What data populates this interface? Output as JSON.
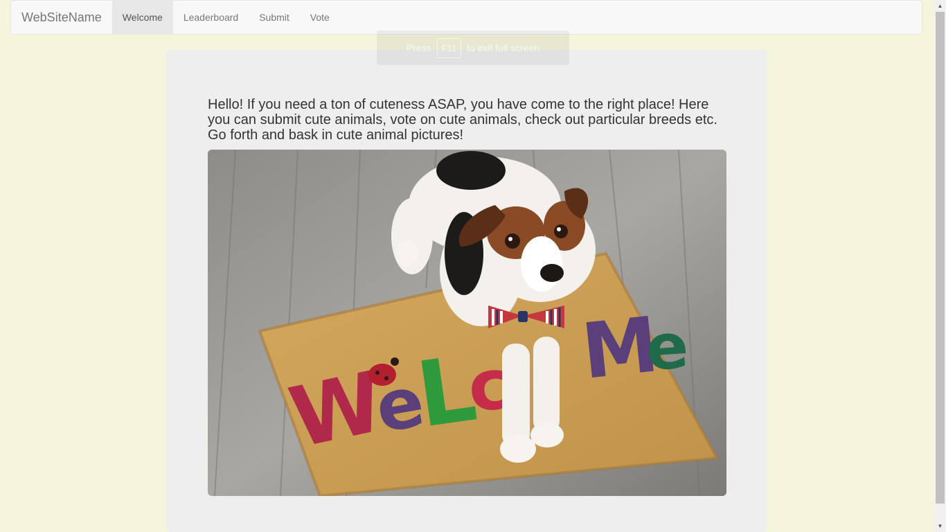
{
  "navbar": {
    "brand": "WebSiteName",
    "items": [
      {
        "label": "Welcome",
        "active": true
      },
      {
        "label": "Leaderboard",
        "active": false
      },
      {
        "label": "Submit",
        "active": false
      },
      {
        "label": "Vote",
        "active": false
      }
    ]
  },
  "fullscreen_toast": {
    "press": "Press",
    "key": "F11",
    "suffix": "to exit full screen"
  },
  "main": {
    "intro": "Hello! If you need a ton of cuteness ASAP, you have come to the right place! Here you can submit cute animals, vote on cute animals, check out particular breeds etc. Go forth and bask in cute animal pictures!",
    "image_subject": "dog-on-welcome-mat",
    "image_mat_text": "Welcome"
  },
  "colors": {
    "page_background": "#f5f5dc",
    "navbar_background": "#f8f8f8",
    "active_tab": "#e7e7e7",
    "panel_background": "#eeeeee"
  }
}
